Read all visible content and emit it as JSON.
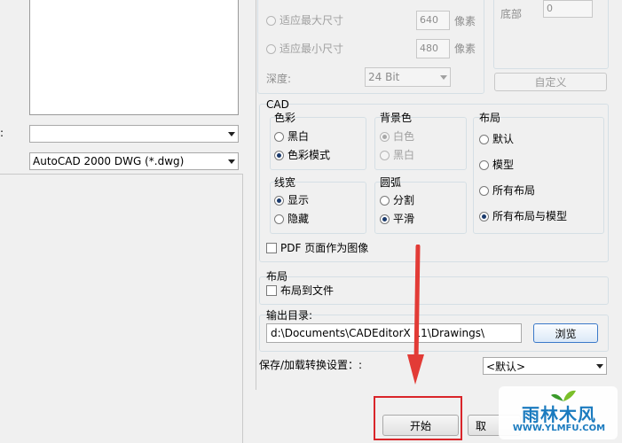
{
  "left": {
    "combo1_value": "",
    "combo2_value": "AutoCAD 2000 DWG (*.dwg)",
    "colon": ":"
  },
  "image": {
    "fit_max_label": "适应最大尺寸",
    "fit_min_label": "适应最小尺寸",
    "width_value": "640",
    "height_value": "480",
    "unit_pixel": "像素",
    "depth_label": "深度:",
    "depth_value": "24 Bit",
    "bottom_label": "底部",
    "bottom_value": "0",
    "custom_button": "自定义"
  },
  "cad": {
    "title": "CAD",
    "color_group": {
      "title": "色彩",
      "opt_bw": "黑白",
      "opt_color": "色彩模式",
      "selected": "色彩模式"
    },
    "bg_group": {
      "title": "背景色",
      "opt_white": "白色",
      "opt_black": "黑白",
      "selected": "白色"
    },
    "lineweight_group": {
      "title": "线宽",
      "opt_show": "显示",
      "opt_hide": "隐藏",
      "selected": "显示"
    },
    "arc_group": {
      "title": "圆弧",
      "opt_split": "分割",
      "opt_smooth": "平滑",
      "selected": "平滑"
    },
    "layout_group": {
      "title": "布局",
      "opt_default": "默认",
      "opt_model": "模型",
      "opt_all_layouts": "所有布局",
      "opt_all_layouts_model": "所有布局与模型",
      "selected": "所有布局与模型"
    },
    "pdf_checkbox": "PDF 页面作为图像"
  },
  "layout_section": {
    "title": "布局",
    "layout_to_file": "布局到文件"
  },
  "output": {
    "label": "输出目录:",
    "path": "d:\\Documents\\CADEditorX 11\\Drawings\\",
    "browse_button": "浏览"
  },
  "save_settings": {
    "label": "保存/加载转换设置：:",
    "value": "<默认>"
  },
  "footer": {
    "start_button": "开始",
    "cancel_partial": "取"
  },
  "watermark": {
    "brand": "雨林木风",
    "url": "WWW.YLMFU.COM"
  },
  "colors": {
    "highlight": "#d9252a",
    "arrow": "#e23b36",
    "window_bg": "#f0f0f0"
  }
}
